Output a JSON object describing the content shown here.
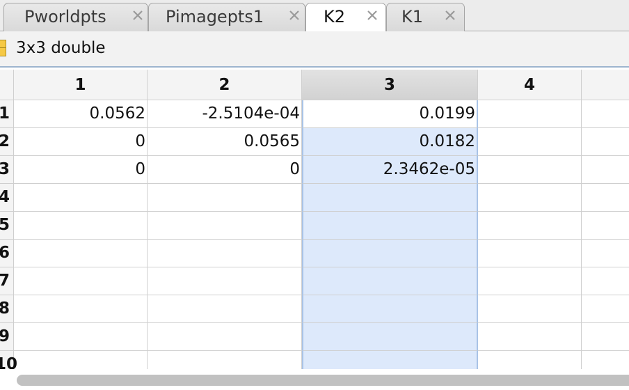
{
  "tabs": [
    {
      "label": "Pworldpts",
      "active": false
    },
    {
      "label": "Pimagepts1",
      "active": false
    },
    {
      "label": "K2",
      "active": true
    },
    {
      "label": "K1",
      "active": false
    }
  ],
  "variable_info": {
    "icon": "matrix-icon",
    "label": "3x3 double"
  },
  "grid": {
    "column_headers": [
      "1",
      "2",
      "3",
      "4",
      ""
    ],
    "row_headers": [
      "1",
      "2",
      "3",
      "4",
      "5",
      "6",
      "7",
      "8",
      "9",
      "10"
    ],
    "selected_column": "3",
    "rows": [
      [
        "0.0562",
        "-2.5104e-04",
        "0.0199",
        "",
        ""
      ],
      [
        "0",
        "0.0565",
        "0.0182",
        "",
        ""
      ],
      [
        "0",
        "0",
        "2.3462e-05",
        "",
        ""
      ],
      [
        "",
        "",
        "",
        "",
        ""
      ],
      [
        "",
        "",
        "",
        "",
        ""
      ],
      [
        "",
        "",
        "",
        "",
        ""
      ],
      [
        "",
        "",
        "",
        "",
        ""
      ],
      [
        "",
        "",
        "",
        "",
        ""
      ],
      [
        "",
        "",
        "",
        "",
        ""
      ],
      [
        "",
        "",
        "",
        "",
        ""
      ]
    ]
  },
  "colors": {
    "selection": "#dde9fb",
    "selection_border": "#a9c3e6",
    "tab_active": "#ffffff",
    "icon_fill": "#f6c945"
  }
}
